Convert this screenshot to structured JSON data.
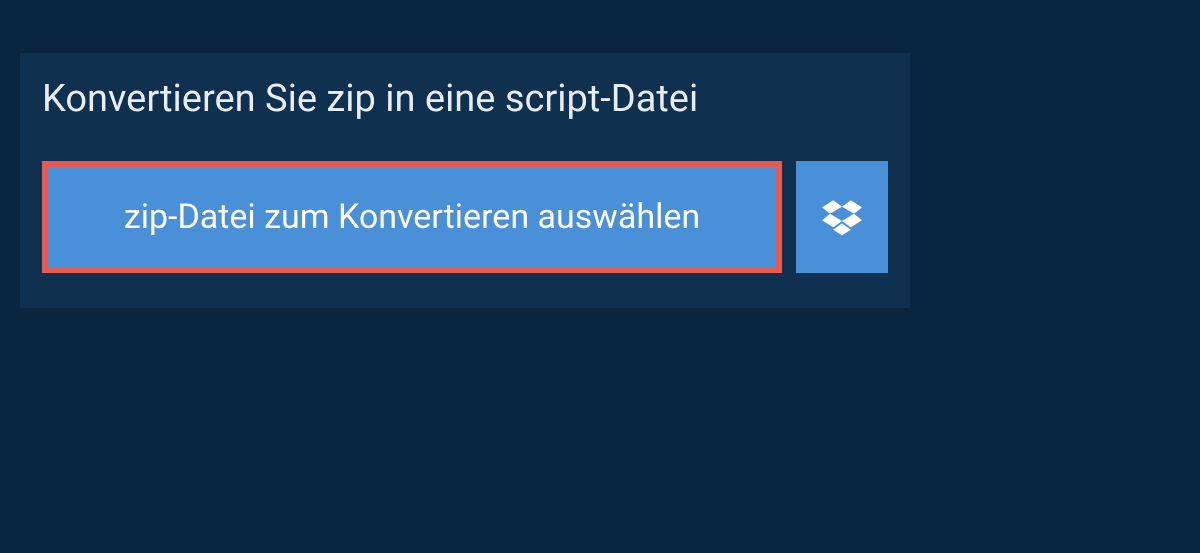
{
  "heading": "Konvertieren Sie zip in eine script-Datei",
  "select_button_label": "zip-Datei zum Konvertieren auswählen",
  "colors": {
    "page_background": "#0a2540",
    "panel_background": "#10304f",
    "button_background": "#4a90d9",
    "highlight_border": "#e85a4f",
    "text_light": "#e8eef4",
    "text_white": "#ffffff"
  }
}
